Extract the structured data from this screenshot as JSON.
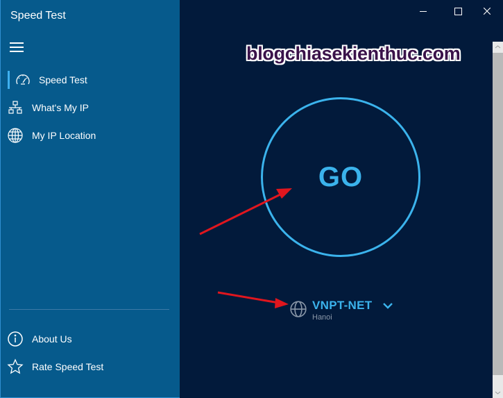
{
  "app": {
    "title": "Speed Test"
  },
  "sidebar": {
    "menu_icon": "hamburger-icon",
    "items": [
      {
        "label": "Speed Test",
        "icon": "speedometer-icon",
        "active": true
      },
      {
        "label": "What's My IP",
        "icon": "network-icon",
        "active": false
      },
      {
        "label": "My IP Location",
        "icon": "globe-icon",
        "active": false
      }
    ],
    "footer_items": [
      {
        "label": "About Us",
        "icon": "info-icon"
      },
      {
        "label": "Rate Speed Test",
        "icon": "star-icon"
      }
    ]
  },
  "window_controls": {
    "minimize": "minimize-icon",
    "maximize": "maximize-icon",
    "close": "close-icon"
  },
  "main": {
    "watermark": "blogchiasekienthuc.com",
    "go_label": "GO",
    "isp": {
      "name": "VNPT-NET",
      "location": "Hanoi",
      "icon": "globe-icon",
      "dropdown_icon": "chevron-down-icon"
    }
  },
  "colors": {
    "sidebar_bg": "#065a8c",
    "main_bg": "#021a3b",
    "accent": "#3bb3ec",
    "annotation_arrow": "#e0161e"
  }
}
